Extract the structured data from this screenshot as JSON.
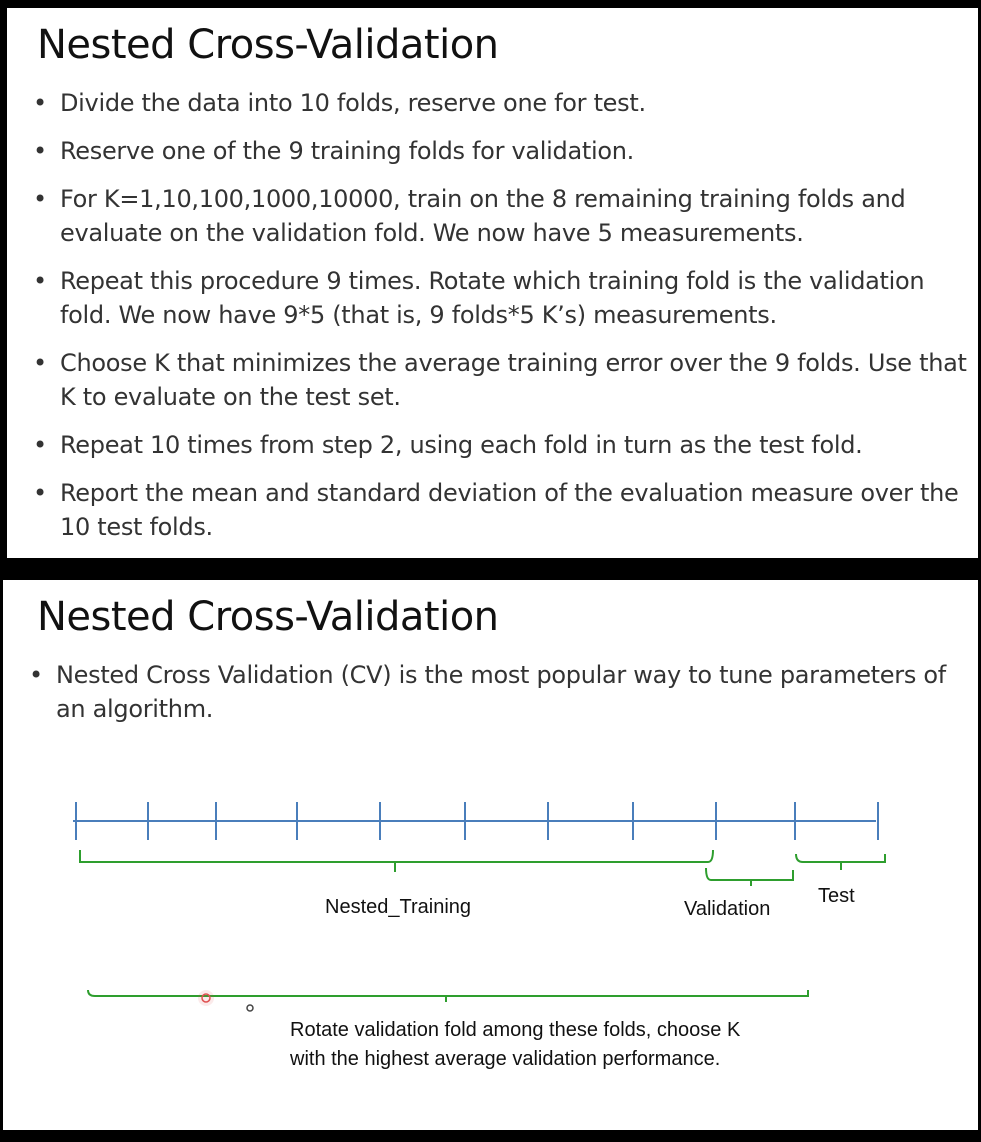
{
  "slide1": {
    "title": "Nested Cross-Validation",
    "bullets": [
      "Divide the data into 10 folds, reserve one for test.",
      "Reserve one of the 9 training folds for validation.",
      "For K=1,10,100,1000,10000, train on the 8 remaining training folds and evaluate on the validation fold. We now have 5 measurements.",
      "Repeat this procedure 9 times. Rotate which training fold is the validation fold. We now have 9*5 (that is, 9 folds*5 K’s) measurements.",
      "Choose K that minimizes the average training error over the 9 folds. Use that K to evaluate on the test set.",
      "Repeat 10 times from step 2, using each fold in turn as the test fold.",
      "Report the mean and standard deviation of the evaluation measure over the 10 test folds."
    ]
  },
  "slide2": {
    "title": "Nested Cross-Validation",
    "bullets": [
      "Nested Cross Validation (CV) is the most popular way to tune parameters of an algorithm."
    ],
    "diagram": {
      "fold_count": 10,
      "labels": {
        "nested_training": "Nested_Training",
        "validation": "Validation",
        "test": "Test"
      },
      "note": "Rotate validation fold among these folds, choose K with the highest average validation performance.",
      "colors": {
        "axis": "#4a7ebb",
        "brace": "#2e9e2e",
        "red_dot": "#e05050",
        "black_dot": "#444444"
      }
    }
  }
}
